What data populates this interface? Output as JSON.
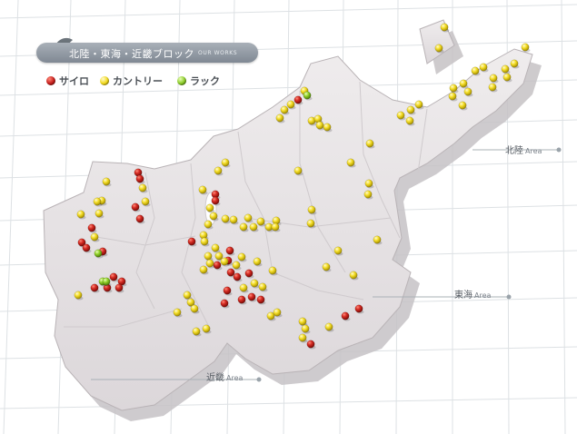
{
  "header": {
    "title": "北陸・東海・近畿ブロック",
    "subtitle": "OUR WORKS"
  },
  "legend": [
    {
      "label": "サイロ",
      "color": "#c8201e"
    },
    {
      "label": "カントリー",
      "color": "#f2da1e"
    },
    {
      "label": "ラック",
      "color": "#8ccc2a"
    }
  ],
  "areas": {
    "hokuriku": {
      "jp": "北陸",
      "en": "Area"
    },
    "tokai": {
      "jp": "東海",
      "en": "Area"
    },
    "kinki": {
      "jp": "近畿",
      "en": "Area"
    }
  },
  "colors": {
    "land": "#e7e3e5",
    "land_edge": "#b7b1b4",
    "grid": "#d9dde0",
    "silo": "#c8201e",
    "country": "#f2da1e",
    "rack": "#8ccc2a"
  }
}
